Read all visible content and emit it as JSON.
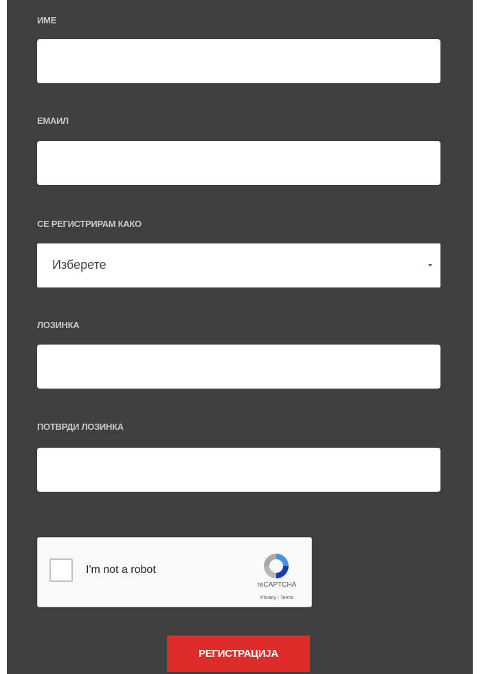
{
  "form": {
    "fields": [
      {
        "label": "ИМЕ",
        "value": "",
        "placeholder": ""
      },
      {
        "label": "ЕМАИЛ",
        "value": "",
        "placeholder": ""
      },
      {
        "label": "СЕ РЕГИСТРИРАМ КАКО",
        "selected": "Изберете"
      },
      {
        "label": "ЛОЗИНКА",
        "value": "",
        "placeholder": ""
      },
      {
        "label": "ПОТВРДИ ЛОЗИНКА",
        "value": "",
        "placeholder": ""
      }
    ],
    "submit_label": "РЕГИСТРАЦИЈА"
  },
  "captcha": {
    "label": "I'm not a robot",
    "brand": "reCAPTCHA",
    "privacy": "Privacy",
    "separator": " - ",
    "terms": "Terms",
    "icon": "recaptcha-icon"
  },
  "colors": {
    "panel_background": "#3f3f3f",
    "label_text": "#c9c9c9",
    "button_accent": "#e02b2b"
  },
  "icons": {
    "select_caret": "caret-down-icon"
  }
}
